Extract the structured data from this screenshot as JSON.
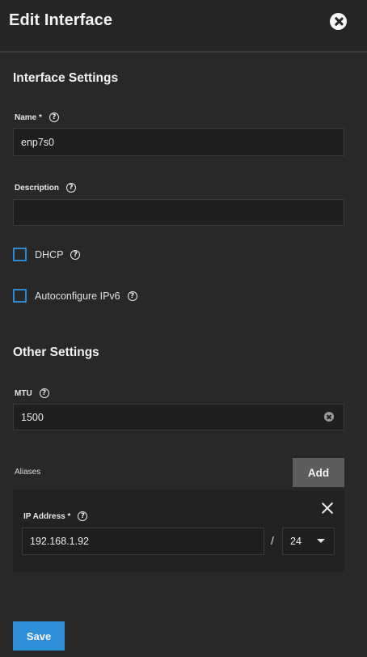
{
  "header": {
    "title": "Edit Interface",
    "close_icon": "close-circle-icon"
  },
  "interface_settings": {
    "title": "Interface Settings",
    "name": {
      "label": "Name *",
      "value": "enp7s0"
    },
    "description": {
      "label": "Description",
      "value": ""
    },
    "dhcp": {
      "label": "DHCP",
      "checked": false
    },
    "autoconfigure_ipv6": {
      "label": "Autoconfigure IPv6",
      "checked": false
    }
  },
  "other_settings": {
    "title": "Other Settings",
    "mtu": {
      "label": "MTU",
      "value": "1500"
    }
  },
  "aliases": {
    "label": "Aliases",
    "add_label": "Add",
    "items": [
      {
        "ip_label": "IP Address *",
        "ip_value": "192.168.1.92",
        "separator": "/",
        "netmask": "24"
      }
    ]
  },
  "actions": {
    "save_label": "Save"
  },
  "colors": {
    "background": "#282828",
    "accent": "#2f8fd8",
    "input_bg": "#1f1f1f",
    "add_button": "#5d5d5d"
  },
  "icons": {
    "help": "help-circle-icon",
    "clear": "clear-circle-icon",
    "remove": "close-icon",
    "dropdown": "caret-down-icon"
  }
}
